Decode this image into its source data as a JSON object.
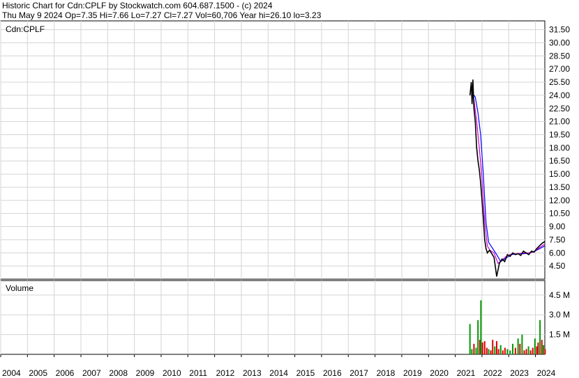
{
  "header": {
    "line1": "Historic Chart for Cdn:CPLF by Stockwatch.com 604.687.1500 - (c) 2024",
    "line2": "Thu May  9 2024  Op=7.35  Hi=7.66  Lo=7.27  Cl=7.27  Vol=60,706  Year hi=26.10  lo=3.23"
  },
  "chart_data": [
    {
      "type": "line",
      "panel_label": "Cdn:CPLF",
      "x_unit": "year",
      "ylim": [
        3.0,
        32.5
      ],
      "yticks": [
        "31.50",
        "30.00",
        "28.50",
        "27.00",
        "25.50",
        "24.00",
        "22.50",
        "21.00",
        "19.50",
        "18.00",
        "16.50",
        "15.00",
        "13.50",
        "12.00",
        "10.50",
        "9.00",
        "7.50",
        "6.00",
        "4.50"
      ],
      "colors": {
        "price": "#000000",
        "ma_short": "#cc00cc",
        "ma_long": "#0000ff"
      },
      "series": [
        {
          "role": "price",
          "x": [
            2021.55,
            2021.6,
            2021.63,
            2021.66,
            2021.7,
            2021.75,
            2021.8,
            2021.85,
            2021.9,
            2021.95,
            2022.0,
            2022.05,
            2022.1,
            2022.15,
            2022.2,
            2022.28,
            2022.35,
            2022.45,
            2022.55,
            2022.65,
            2022.75,
            2022.85,
            2022.95,
            2023.05,
            2023.15,
            2023.25,
            2023.35,
            2023.45,
            2023.55,
            2023.65,
            2023.75,
            2023.85,
            2023.95,
            2024.05,
            2024.15,
            2024.25,
            2024.35
          ],
          "y": [
            24.0,
            25.5,
            23.0,
            25.8,
            22.5,
            21.0,
            18.0,
            16.5,
            15.5,
            14.0,
            12.0,
            10.0,
            7.5,
            6.5,
            6.0,
            6.3,
            6.0,
            5.5,
            3.3,
            4.8,
            5.3,
            5.0,
            5.8,
            5.6,
            6.0,
            5.8,
            5.9,
            5.7,
            6.2,
            6.0,
            5.8,
            6.2,
            6.1,
            6.5,
            6.8,
            7.1,
            7.3
          ]
        },
        {
          "role": "ma_short",
          "x": [
            2021.6,
            2021.7,
            2021.8,
            2021.9,
            2022.0,
            2022.1,
            2022.2,
            2022.3,
            2022.45,
            2022.6,
            2022.75,
            2022.95,
            2023.15,
            2023.35,
            2023.55,
            2023.75,
            2023.95,
            2024.15,
            2024.35
          ],
          "y": [
            24.0,
            23.5,
            21.0,
            18.0,
            14.5,
            9.5,
            6.8,
            6.3,
            6.0,
            4.8,
            5.2,
            5.7,
            5.9,
            5.9,
            6.0,
            6.0,
            6.1,
            6.6,
            7.0
          ]
        },
        {
          "role": "ma_long",
          "x": [
            2021.65,
            2021.75,
            2021.85,
            2021.95,
            2022.05,
            2022.15,
            2022.25,
            2022.4,
            2022.55,
            2022.7,
            2022.9,
            2023.1,
            2023.3,
            2023.55,
            2023.8,
            2024.05,
            2024.35
          ],
          "y": [
            24.2,
            23.8,
            22.0,
            19.5,
            15.0,
            9.5,
            7.2,
            6.5,
            5.8,
            5.0,
            5.4,
            5.8,
            5.9,
            5.9,
            6.0,
            6.3,
            6.8
          ]
        }
      ]
    },
    {
      "type": "bar",
      "panel_label": "Volume",
      "y_unit": "millions",
      "ylim": [
        0,
        5.6
      ],
      "yticks": [
        "4.5 M",
        "3.0 M",
        "1.5 M"
      ],
      "colors": {
        "up": "#009900",
        "down": "#dd0000"
      },
      "bars": [
        {
          "x": 2021.55,
          "v": 2.3,
          "c": "up"
        },
        {
          "x": 2021.62,
          "v": 0.4,
          "c": "up"
        },
        {
          "x": 2021.7,
          "v": 0.8,
          "c": "down"
        },
        {
          "x": 2021.78,
          "v": 0.5,
          "c": "up"
        },
        {
          "x": 2021.85,
          "v": 2.6,
          "c": "up"
        },
        {
          "x": 2021.92,
          "v": 1.1,
          "c": "down"
        },
        {
          "x": 2021.96,
          "v": 4.1,
          "c": "up"
        },
        {
          "x": 2022.02,
          "v": 0.9,
          "c": "down"
        },
        {
          "x": 2022.1,
          "v": 1.0,
          "c": "down"
        },
        {
          "x": 2022.18,
          "v": 0.5,
          "c": "down"
        },
        {
          "x": 2022.25,
          "v": 0.4,
          "c": "up"
        },
        {
          "x": 2022.33,
          "v": 0.3,
          "c": "down"
        },
        {
          "x": 2022.4,
          "v": 1.1,
          "c": "down"
        },
        {
          "x": 2022.48,
          "v": 0.6,
          "c": "up"
        },
        {
          "x": 2022.55,
          "v": 1.0,
          "c": "down"
        },
        {
          "x": 2022.62,
          "v": 0.4,
          "c": "down"
        },
        {
          "x": 2022.7,
          "v": 0.7,
          "c": "up"
        },
        {
          "x": 2022.78,
          "v": 0.3,
          "c": "down"
        },
        {
          "x": 2022.86,
          "v": 0.5,
          "c": "down"
        },
        {
          "x": 2022.95,
          "v": 0.4,
          "c": "up"
        },
        {
          "x": 2023.05,
          "v": 0.3,
          "c": "up"
        },
        {
          "x": 2023.15,
          "v": 0.8,
          "c": "up"
        },
        {
          "x": 2023.25,
          "v": 0.5,
          "c": "down"
        },
        {
          "x": 2023.35,
          "v": 1.2,
          "c": "up"
        },
        {
          "x": 2023.42,
          "v": 0.8,
          "c": "down"
        },
        {
          "x": 2023.5,
          "v": 1.5,
          "c": "up"
        },
        {
          "x": 2023.58,
          "v": 0.3,
          "c": "down"
        },
        {
          "x": 2023.66,
          "v": 0.4,
          "c": "down"
        },
        {
          "x": 2023.74,
          "v": 0.6,
          "c": "up"
        },
        {
          "x": 2023.82,
          "v": 0.3,
          "c": "down"
        },
        {
          "x": 2023.9,
          "v": 0.5,
          "c": "down"
        },
        {
          "x": 2023.98,
          "v": 1.2,
          "c": "up"
        },
        {
          "x": 2024.05,
          "v": 0.6,
          "c": "down"
        },
        {
          "x": 2024.1,
          "v": 0.9,
          "c": "down"
        },
        {
          "x": 2024.17,
          "v": 2.6,
          "c": "up"
        },
        {
          "x": 2024.24,
          "v": 1.1,
          "c": "down"
        },
        {
          "x": 2024.3,
          "v": 0.7,
          "c": "up"
        },
        {
          "x": 2024.36,
          "v": 0.4,
          "c": "down"
        }
      ]
    }
  ],
  "x_axis": {
    "range": [
      2004,
      2024.35
    ],
    "labels": [
      "2004",
      "2005",
      "2006",
      "2007",
      "2008",
      "2009",
      "2010",
      "2011",
      "2012",
      "2013",
      "2014",
      "2015",
      "2016",
      "2017",
      "2018",
      "2019",
      "2020",
      "2021",
      "2022",
      "2023",
      "2024"
    ]
  }
}
